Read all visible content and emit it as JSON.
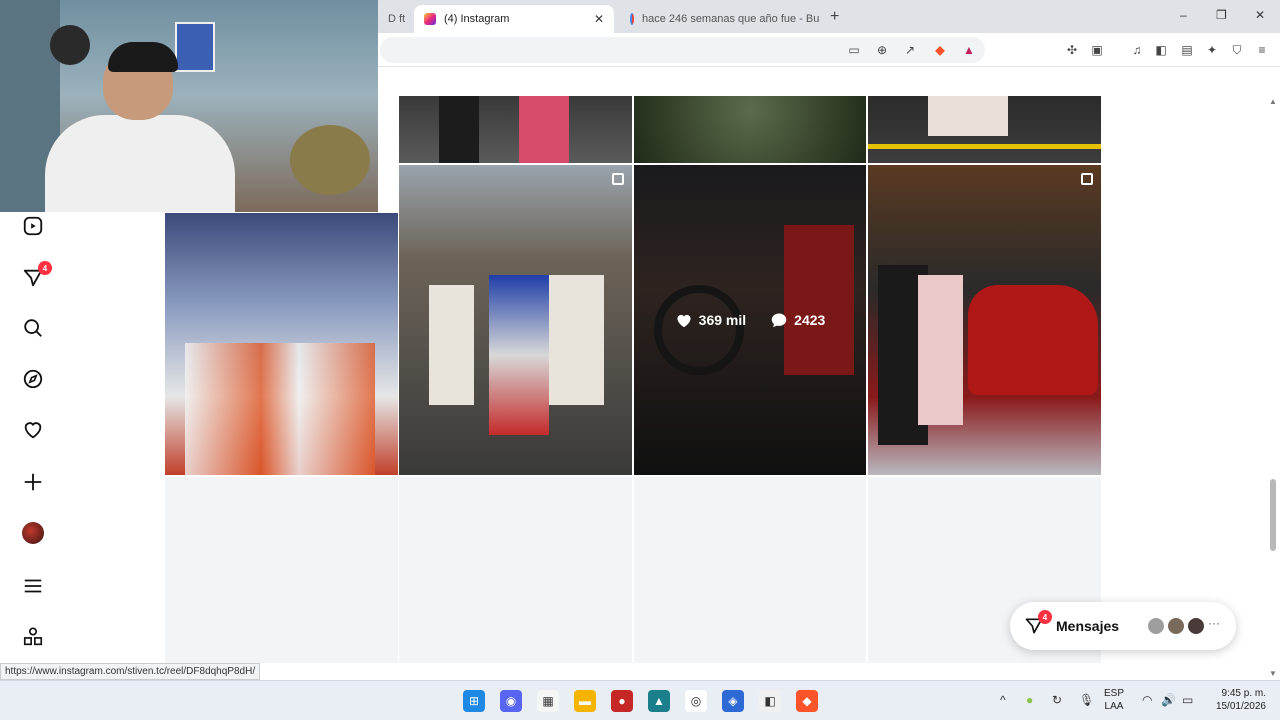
{
  "browser": {
    "tabs": [
      {
        "label": "D ft",
        "active": false
      },
      {
        "label": "(4) Instagram",
        "active": true
      },
      {
        "label": "hace 246 semanas que año fue - Bus",
        "active": false
      }
    ],
    "new_tab": "+",
    "window_controls": {
      "minimize": "–",
      "restore": "❐",
      "close": "✕"
    },
    "tab_close": "✕"
  },
  "sidebar": {
    "notifications_badge": "4",
    "items": [
      "reels-icon",
      "messages-icon",
      "search-icon",
      "explore-icon",
      "heart-icon",
      "create-icon",
      "profile-avatar",
      "menu-icon",
      "more-apps-icon"
    ]
  },
  "grid": {
    "hovered_post": {
      "likes": "369 mil",
      "comments": "2423"
    }
  },
  "messages": {
    "label": "Mensajes",
    "badge": "4",
    "more": "···"
  },
  "status_url": "https://www.instagram.com/stiven.tc/reel/DF8dqhqP8dH/",
  "taskbar": {
    "language": "ESP",
    "layout": "LAA",
    "time": "9:45 p. m.",
    "date": "15/01/2026",
    "tray_chevron": "^"
  },
  "colors": {
    "badge": "#ff3040",
    "taskbar": "#e9eef4",
    "tabbar": "#dfe3e8"
  }
}
